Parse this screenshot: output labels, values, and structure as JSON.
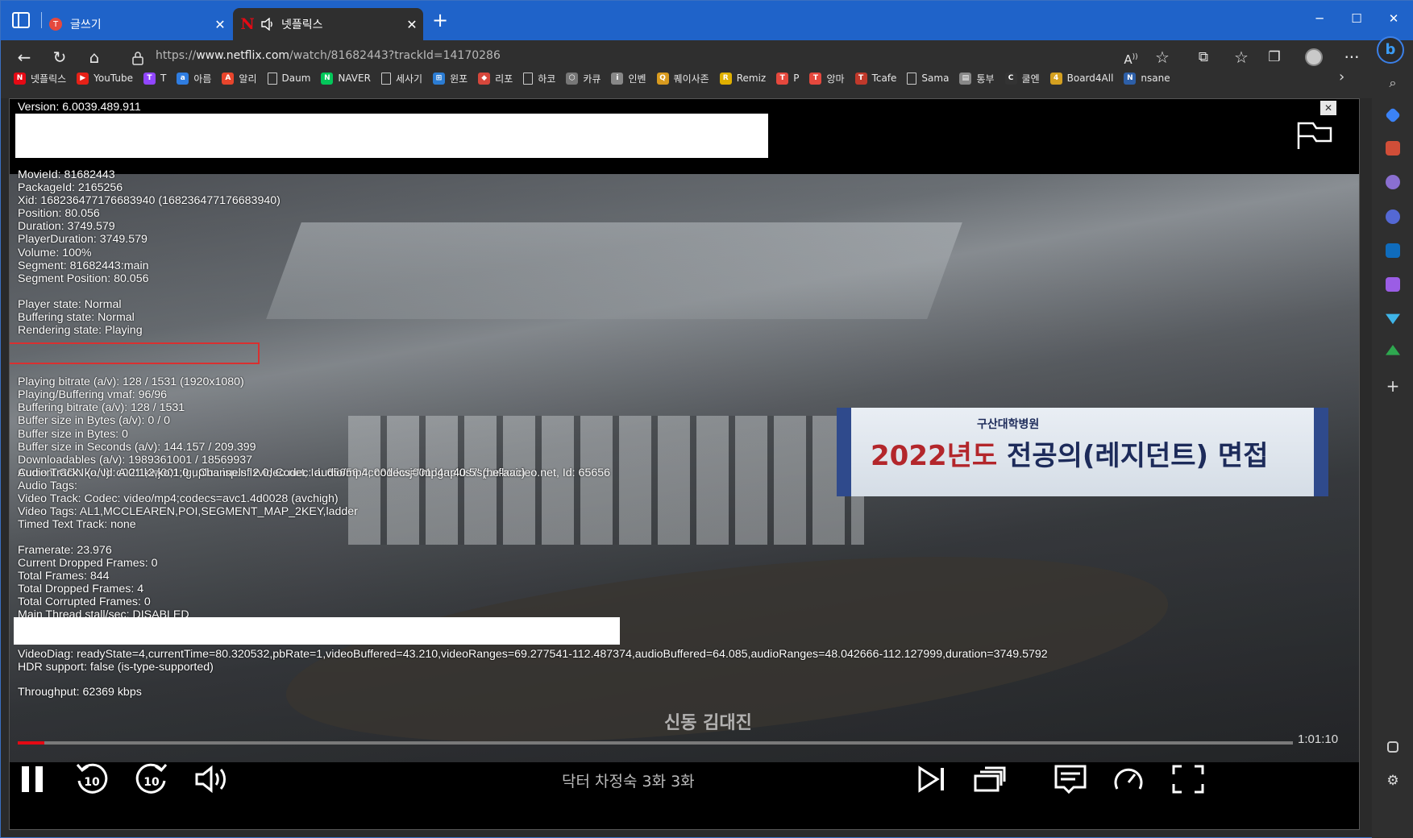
{
  "tabs": [
    {
      "title": "글쓰기",
      "favicon": "T",
      "active": false
    },
    {
      "title": "넷플릭스",
      "favicon": "N",
      "active": true
    }
  ],
  "window_controls": {
    "minimize": "─",
    "maximize": "☐",
    "close": "✕"
  },
  "url": {
    "scheme": "https://",
    "host": "www.netflix.com",
    "path": "/watch/81682443?trackId=14170286"
  },
  "bookmarks": [
    {
      "label": "넷플릭스",
      "color": "#e50914",
      "glyph": "N"
    },
    {
      "label": "YouTube",
      "color": "#e62117",
      "glyph": "▶"
    },
    {
      "label": "T",
      "color": "#9146ff",
      "glyph": "T"
    },
    {
      "label": "아름",
      "color": "#2f7de1",
      "glyph": "a"
    },
    {
      "label": "알리",
      "color": "#e8452c",
      "glyph": "A"
    },
    {
      "label": "Daum",
      "color": "#555555",
      "glyph": ""
    },
    {
      "label": "NAVER",
      "color": "#03c75a",
      "glyph": "N"
    },
    {
      "label": "세사기",
      "color": "#555555",
      "glyph": ""
    },
    {
      "label": "윈포",
      "color": "#2b7cd3",
      "glyph": "⊞"
    },
    {
      "label": "리포",
      "color": "#d6473b",
      "glyph": "◆"
    },
    {
      "label": "하코",
      "color": "#555555",
      "glyph": ""
    },
    {
      "label": "카큐",
      "color": "#777777",
      "glyph": "⬡"
    },
    {
      "label": "인벤",
      "color": "#888888",
      "glyph": "i"
    },
    {
      "label": "퀘이사존",
      "color": "#d89a1e",
      "glyph": "Q"
    },
    {
      "label": "Remiz",
      "color": "#e0b000",
      "glyph": "R"
    },
    {
      "label": "P",
      "color": "#e5483d",
      "glyph": "T"
    },
    {
      "label": "앙마",
      "color": "#e5483d",
      "glyph": "T"
    },
    {
      "label": "Tcafe",
      "color": "#c0392b",
      "glyph": "T"
    },
    {
      "label": "Sama",
      "color": "#555555",
      "glyph": ""
    },
    {
      "label": "통부",
      "color": "#888888",
      "glyph": "▤"
    },
    {
      "label": "쿨엔",
      "color": "#333333",
      "glyph": "C"
    },
    {
      "label": "Board4All",
      "color": "#d4a020",
      "glyph": "4"
    },
    {
      "label": "nsane",
      "color": "#2d5fa8",
      "glyph": "N"
    }
  ],
  "diagnostics": {
    "version": "Version: 6.0039.489.911",
    "block1": [
      "MovieId: 81682443",
      "PackageId: 2165256",
      "Xid: 168236477176683940 (168236477176683940)",
      "Position: 80.056",
      "Duration: 3749.579",
      "PlayerDuration: 3749.579",
      "Volume: 100%",
      "Segment: 81682443:main",
      "Segment Position: 80.056"
    ],
    "block2": [
      "Player state: Normal",
      "Buffering state: Normal",
      "Rendering state: Playing"
    ],
    "block3": [
      "Playing bitrate (a/v): 128 / 1531 (1920x1080)",
      "Playing/Buffering vmaf: 96/96",
      "Buffering bitrate (a/v): 128 / 1531",
      "Buffer size in Bytes (a/v): 0 / 0",
      "Buffer size in Bytes: 0",
      "Buffer size in Seconds (a/v): 144.157 / 209.399",
      "Downloadables (a/v): 1989361001 / 18569937",
      "Current CDN (a/v): c001.kwj001.lguplus.isp.nflxvideo.net, Id: 65656 / c001.kwj001.lguplus.isp.nflxvideo.net, Id: 65656"
    ],
    "block4": [
      "Audio Track: ko, Id: A:2:1;2;ko;1;0;, Channels: 2.0, Codec: audio/mp4; codecs=\"mp4a.40.5\" (he-aac)",
      "Audio Tags:",
      "Video Track: Codec: video/mp4;codecs=avc1.4d0028 (avchigh)",
      "Video Tags: AL1,MCCLEAREN,POI,SEGMENT_MAP_2KEY,ladder",
      "Timed Text Track: none"
    ],
    "block5": [
      "Framerate: 23.976",
      "Current Dropped Frames: 0",
      "Total Frames: 844",
      "Total Dropped Frames: 4",
      "Total Corrupted Frames: 0",
      "Main Thread stall/sec: DISABLED"
    ],
    "block6": [
      "VideoDiag: readyState=4,currentTime=80.320532,pbRate=1,videoBuffered=43.210,videoRanges=69.277541-112.487374,audioBuffered=64.085,audioRanges=48.042666-112.127999,duration=3749.5792",
      "HDR support: false (is-type-supported)"
    ],
    "throughput": "Throughput: 62369 kbps"
  },
  "scene": {
    "banner_sub": "구산대학병원",
    "banner_year": "2022년도",
    "banner_main": " 전공의(레지던트) 면접",
    "subtitle": "신동 김대진"
  },
  "player": {
    "time_remaining": "1:01:10",
    "episode_title": "닥터 차정숙 3화  3화",
    "progress_fraction": 0.021,
    "close_label": "✕"
  },
  "colors": {
    "edge_blue": "#1f63c9",
    "netflix_red": "#e50914",
    "highlight_red": "#d93030"
  }
}
